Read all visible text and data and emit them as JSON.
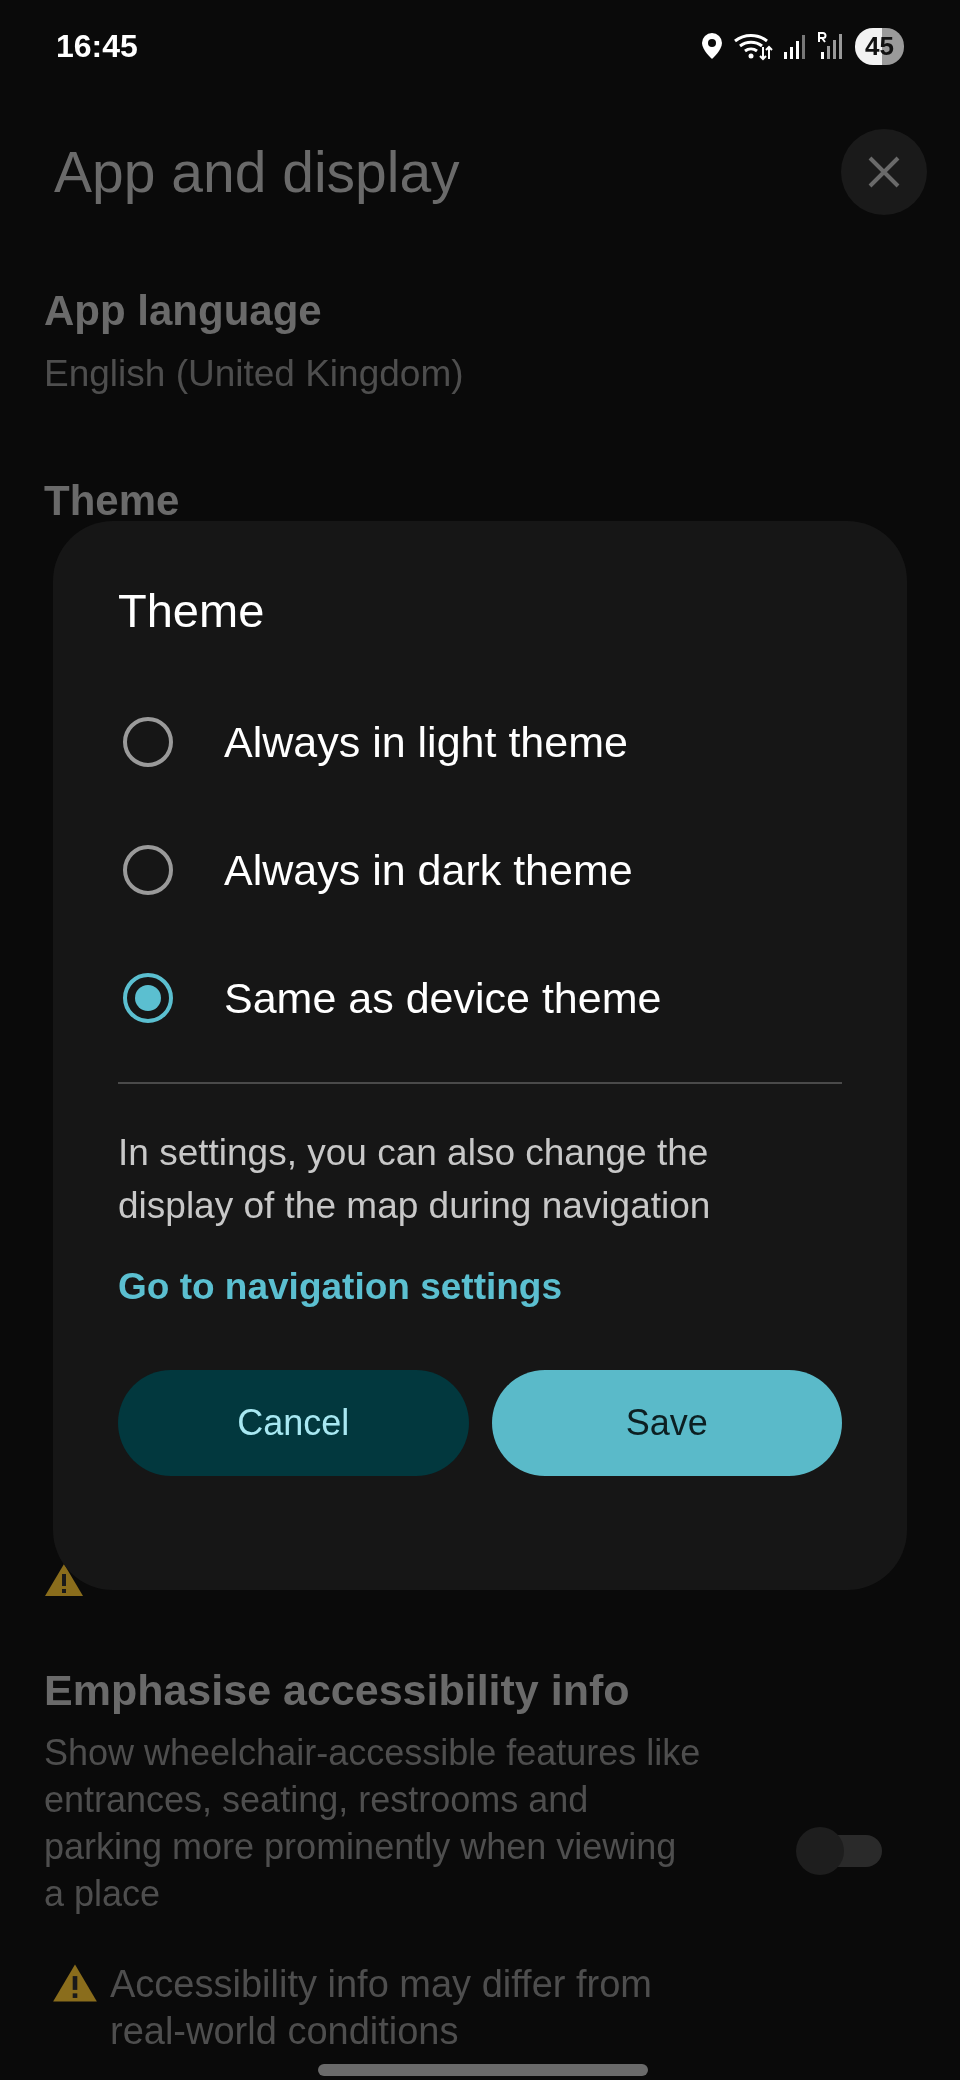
{
  "status_bar": {
    "time": "16:45",
    "battery": "45"
  },
  "header": {
    "title": "App and display"
  },
  "settings": [
    {
      "kind": "text",
      "title": "App language",
      "subtitle": "English (United Kingdom)"
    },
    {
      "kind": "text",
      "title": "Theme"
    },
    {
      "kind": "warning"
    },
    {
      "kind": "toggle",
      "title": "Emphasise accessibility info",
      "subtitle": "Show wheelchair-accessible features like entrances, seating, restrooms and parking more prominently when viewing a place",
      "on": false,
      "warning": "Accessibility info may differ from real-world conditions"
    }
  ],
  "dialog": {
    "title": "Theme",
    "options": [
      {
        "label": "Always in light theme",
        "selected": false
      },
      {
        "label": "Always in dark theme",
        "selected": false
      },
      {
        "label": "Same as device theme",
        "selected": true
      }
    ],
    "info": "In settings, you can also change the display of the map during navigation",
    "link": "Go to navigation settings",
    "buttons": [
      {
        "label": "Cancel",
        "kind": "secondary"
      },
      {
        "label": "Save",
        "kind": "primary"
      }
    ]
  }
}
